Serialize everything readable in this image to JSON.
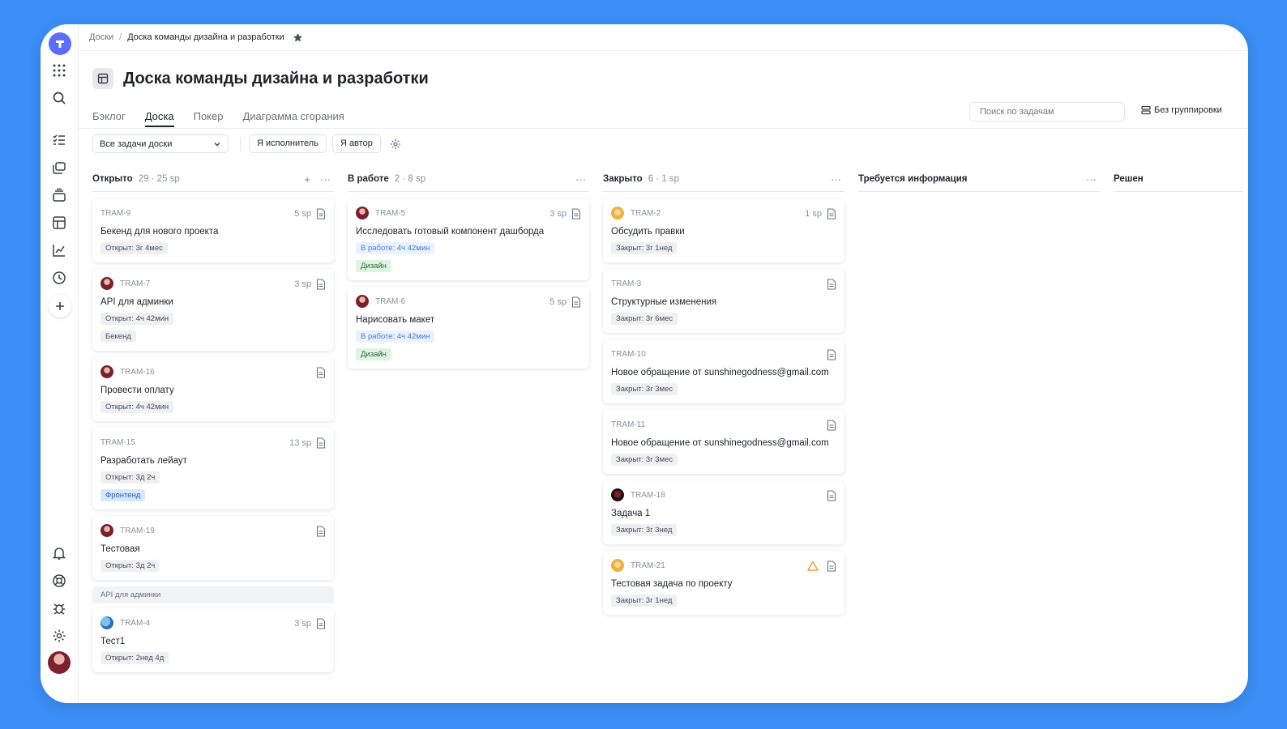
{
  "breadcrumb": {
    "root": "Доски",
    "current": "Доска команды дизайна и разработки"
  },
  "page_title": "Доска команды дизайна и разработки",
  "tabs": [
    "Бэклог",
    "Доска",
    "Покер",
    "Диаграмма сгорания"
  ],
  "active_tab": "Доска",
  "search": {
    "placeholder": "Поиск по задачам"
  },
  "grouping_label": "Без группировки",
  "filters": {
    "select_value": "Все задачи доски",
    "assignee_btn": "Я исполнитель",
    "author_btn": "Я автор"
  },
  "columns": [
    {
      "title": "Открыто",
      "stats": "29 · 25 sp",
      "has_add": true,
      "cards": [
        {
          "key": "TRAM-9",
          "sp": "5 sp",
          "title": "Бекенд для нового проекта",
          "avatar": "",
          "tags": [
            {
              "text": "Открыт: 3г 4мес",
              "style": "gray"
            }
          ]
        },
        {
          "key": "TRAM-7",
          "sp": "3 sp",
          "title": "API для админки",
          "avatar": "woman",
          "tags": [
            {
              "text": "Открыт: 4ч 42мин",
              "style": "gray"
            },
            {
              "text": "Бекенд",
              "style": "gray"
            }
          ]
        },
        {
          "key": "TRAM-16",
          "sp": "",
          "title": "Провести оплату",
          "avatar": "woman",
          "tags": [
            {
              "text": "Открыт: 4ч 42мин",
              "style": "gray"
            }
          ]
        },
        {
          "key": "TRAM-15",
          "sp": "13 sp",
          "title": "Разработать лейаут",
          "avatar": "",
          "tags": [
            {
              "text": "Открыт: 3д 2ч",
              "style": "gray"
            },
            {
              "text": "Фронтенд",
              "style": "frontend"
            }
          ]
        },
        {
          "key": "TRAM-19",
          "sp": "",
          "title": "Тестовая",
          "avatar": "woman",
          "tags": [
            {
              "text": "Открыт: 3д 2ч",
              "style": "gray"
            }
          ]
        }
      ],
      "group": {
        "label": "API для админки",
        "cards": [
          {
            "key": "TRAM-4",
            "sp": "3 sp",
            "title": "Тест1",
            "avatar": "globe",
            "tags": [
              {
                "text": "Открыт: 2нед 4д",
                "style": "gray"
              }
            ]
          }
        ]
      }
    },
    {
      "title": "В работе",
      "stats": "2 · 8 sp",
      "has_add": false,
      "cards": [
        {
          "key": "TRAM-5",
          "sp": "3 sp",
          "title": "Исследовать готовый компонент дашборда",
          "avatar": "woman",
          "tags": [
            {
              "text": "В работе: 4ч 42мин",
              "style": "blue"
            },
            {
              "text": "Дизайн",
              "style": "green"
            }
          ]
        },
        {
          "key": "TRAM-6",
          "sp": "5 sp",
          "title": "Нарисовать макет",
          "avatar": "woman",
          "tags": [
            {
              "text": "В работе: 4ч 42мин",
              "style": "blue"
            },
            {
              "text": "Дизайн",
              "style": "green"
            }
          ]
        }
      ]
    },
    {
      "title": "Закрыто",
      "stats": "6 · 1 sp",
      "has_add": false,
      "cards": [
        {
          "key": "TRAM-2",
          "sp": "1 sp",
          "title": "Обсудить правки",
          "avatar": "blonde",
          "tags": [
            {
              "text": "Закрыт: 3г 1нед",
              "style": "gray"
            }
          ]
        },
        {
          "key": "TRAM-3",
          "sp": "",
          "title": "Структурные изменения",
          "avatar": "",
          "tags": [
            {
              "text": "Закрыт: 3г 6мес",
              "style": "gray"
            }
          ]
        },
        {
          "key": "TRAM-10",
          "sp": "",
          "title": "Новое обращение от sunshinegodness@gmail.com",
          "avatar": "",
          "tags": [
            {
              "text": "Закрыт: 3г 3мес",
              "style": "gray"
            }
          ]
        },
        {
          "key": "TRAM-11",
          "sp": "",
          "title": "Новое обращение от sunshinegodness@gmail.com",
          "avatar": "",
          "tags": [
            {
              "text": "Закрыт: 3г 3мес",
              "style": "gray"
            }
          ]
        },
        {
          "key": "TRAM-18",
          "sp": "",
          "title": "Задача 1",
          "avatar": "dark",
          "tags": [
            {
              "text": "Закрыт: 3г 3нед",
              "style": "gray"
            }
          ]
        },
        {
          "key": "TRAM-21",
          "sp": "",
          "title": "Тестовая задача по проекту",
          "avatar": "blonde",
          "warning": true,
          "tags": [
            {
              "text": "Закрыт: 3г 1нед",
              "style": "gray"
            }
          ]
        }
      ]
    },
    {
      "title": "Требуется информация",
      "stats": "",
      "has_add": false,
      "cards": []
    },
    {
      "title": "Решен",
      "stats": "",
      "has_add": false,
      "cards": []
    }
  ],
  "colors": {
    "background": "#3b8ef5",
    "accent": "#5b6cff",
    "warning": "#e8a33c"
  }
}
